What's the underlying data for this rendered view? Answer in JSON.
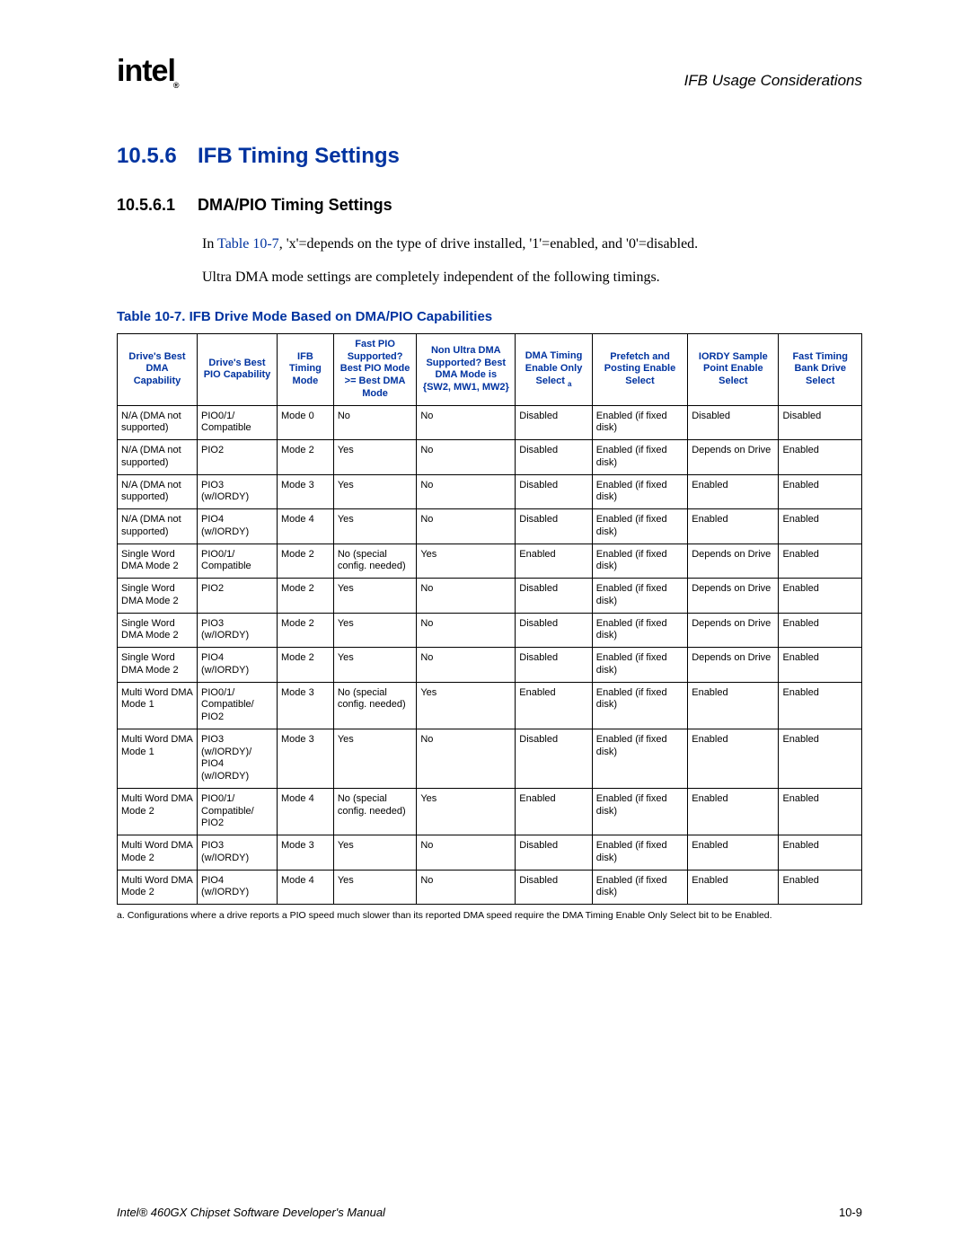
{
  "header": {
    "logo_text": "intel",
    "logo_sub": "®",
    "right": "IFB Usage Considerations"
  },
  "section": {
    "h2_num": "10.5.6",
    "h2_title": "IFB Timing Settings",
    "h3_num": "10.5.6.1",
    "h3_title": "DMA/PIO Timing Settings"
  },
  "paragraphs": {
    "p1_a": "In ",
    "p1_ref": "Table 10-7",
    "p1_b": ", 'x'=depends on the type of drive installed, '1'=enabled, and '0'=disabled.",
    "p2": "Ultra DMA mode settings are completely independent of the following timings."
  },
  "table": {
    "caption": "Table 10-7. IFB Drive Mode Based on DMA/PIO Capabilities",
    "headers": [
      "Drive's Best DMA Capability",
      "Drive's Best PIO Capability",
      "IFB Timing Mode",
      "Fast PIO Supported? Best PIO Mode >= Best DMA Mode",
      "Non Ultra DMA Supported? Best DMA Mode is {SW2, MW1, MW2}",
      "DMA Timing Enable Only Select",
      "Prefetch and Posting Enable Select",
      "IORDY Sample Point Enable Select",
      "Fast Timing Bank Drive Select"
    ],
    "header_sup": "a",
    "rows": [
      [
        "N/A (DMA not supported)",
        "PIO0/1/ Compatible",
        "Mode 0",
        "No",
        "No",
        "Disabled",
        "Enabled (if fixed disk)",
        "Disabled",
        "Disabled"
      ],
      [
        "N/A (DMA not supported)",
        "PIO2",
        "Mode 2",
        "Yes",
        "No",
        "Disabled",
        "Enabled (if fixed disk)",
        "Depends on Drive",
        "Enabled"
      ],
      [
        "N/A (DMA not supported)",
        "PIO3 (w/IORDY)",
        "Mode 3",
        "Yes",
        "No",
        "Disabled",
        "Enabled (if fixed disk)",
        "Enabled",
        "Enabled"
      ],
      [
        "N/A (DMA not supported)",
        "PIO4 (w/IORDY)",
        "Mode 4",
        "Yes",
        "No",
        "Disabled",
        "Enabled (if fixed disk)",
        "Enabled",
        "Enabled"
      ],
      [
        "Single Word DMA Mode 2",
        "PIO0/1/ Compatible",
        "Mode 2",
        "No (special config. needed)",
        "Yes",
        "Enabled",
        "Enabled (if fixed disk)",
        "Depends on Drive",
        "Enabled"
      ],
      [
        "Single Word DMA Mode 2",
        "PIO2",
        "Mode 2",
        "Yes",
        "No",
        "Disabled",
        "Enabled (if fixed disk)",
        "Depends on Drive",
        "Enabled"
      ],
      [
        "Single Word DMA Mode 2",
        "PIO3 (w/IORDY)",
        "Mode 2",
        "Yes",
        "No",
        "Disabled",
        "Enabled (if fixed disk)",
        "Depends on Drive",
        "Enabled"
      ],
      [
        "Single Word DMA Mode 2",
        "PIO4 (w/IORDY)",
        "Mode 2",
        "Yes",
        "No",
        "Disabled",
        "Enabled (if fixed disk)",
        "Depends on Drive",
        "Enabled"
      ],
      [
        "Multi Word DMA Mode 1",
        "PIO0/1/ Compatible/ PIO2",
        "Mode 3",
        "No (special config. needed)",
        "Yes",
        "Enabled",
        "Enabled (if fixed disk)",
        "Enabled",
        "Enabled"
      ],
      [
        "Multi Word DMA Mode 1",
        "PIO3 (w/IORDY)/ PIO4 (w/IORDY)",
        "Mode 3",
        "Yes",
        "No",
        "Disabled",
        "Enabled (if fixed disk)",
        "Enabled",
        "Enabled"
      ],
      [
        "Multi Word DMA Mode 2",
        "PIO0/1/ Compatible/ PIO2",
        "Mode 4",
        "No (special config. needed)",
        "Yes",
        "Enabled",
        "Enabled (if fixed disk)",
        "Enabled",
        "Enabled"
      ],
      [
        "Multi Word DMA Mode 2",
        "PIO3 (w/IORDY)",
        "Mode 3",
        "Yes",
        "No",
        "Disabled",
        "Enabled (if fixed disk)",
        "Enabled",
        "Enabled"
      ],
      [
        "Multi Word DMA Mode 2",
        "PIO4 (w/IORDY)",
        "Mode 4",
        "Yes",
        "No",
        "Disabled",
        "Enabled (if fixed disk)",
        "Enabled",
        "Enabled"
      ]
    ]
  },
  "footnote": {
    "marker": "a.",
    "text": "Configurations where a drive reports a PIO speed much slower than its reported DMA speed require the DMA Timing Enable Only Select bit to be Enabled."
  },
  "footer": {
    "left": "Intel® 460GX Chipset Software Developer's Manual",
    "right": "10-9"
  }
}
